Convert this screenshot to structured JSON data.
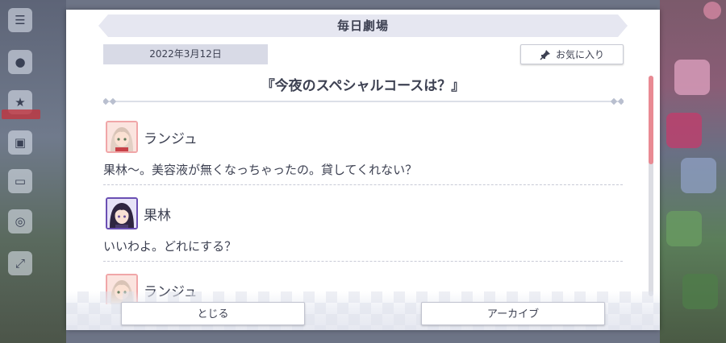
{
  "dialog": {
    "title": "毎日劇場",
    "date": "2022年3月12日",
    "favorite_label": "お気に入り",
    "story_title": "『今夜のスペシャルコースは？』"
  },
  "log": [
    {
      "speaker": "ランジュ",
      "text": "果林〜。美容液が無くなっちゃったの。貸してくれない？",
      "avatar": "lanzhu-avatar"
    },
    {
      "speaker": "果林",
      "text": "いいわよ。どれにする？",
      "avatar": "karin-avatar"
    },
    {
      "speaker": "ランジュ",
      "text": "",
      "avatar": "lanzhu-avatar"
    }
  ],
  "buttons": {
    "close": "とじる",
    "archive": "アーカイブ"
  },
  "colors": {
    "accent_pink": "#e98a93",
    "text": "#3d4152",
    "title_bar": "#e6e7f1"
  }
}
